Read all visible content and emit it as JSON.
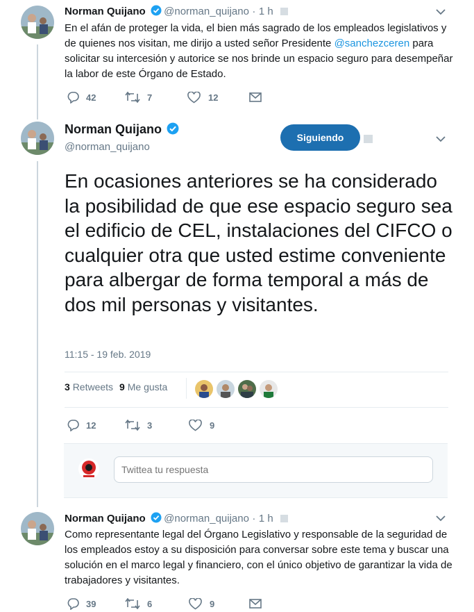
{
  "tweets": [
    {
      "name": "Norman Quijano",
      "handle": "@norman_quijano",
      "time": "1 h",
      "dot": "·",
      "text": "En el afán de proteger la vida, el bien más sagrado de los empleados legislativos y de quienes nos visitan, me dirijo a usted señor Presidente ",
      "mention": "@sanchezceren",
      "text_after": " para solicitar su intercesión y autorice se nos brinde un espacio seguro para desempeñar la labor de este Órgano de Estado.",
      "replies": "42",
      "retweets": "7",
      "likes": "12"
    },
    {
      "name": "Norman Quijano",
      "handle": "@norman_quijano",
      "follow_label": "Siguiendo",
      "text": "En ocasiones anteriores se ha considerado la posibilidad de que ese espacio seguro sea el edificio de CEL, instalaciones del CIFCO o cualquier otra que usted estime conveniente para albergar de forma temporal a más de dos mil personas y visitantes.",
      "timestamp": "11:15 - 19 feb. 2019",
      "retweets_count": "3",
      "retweets_label": "Retweets",
      "likes_count": "9",
      "likes_label": "Me gusta",
      "replies": "12",
      "retweets": "3",
      "likes": "9"
    },
    {
      "name": "Norman Quijano",
      "handle": "@norman_quijano",
      "time": "1 h",
      "dot": "·",
      "text": "Como representante legal del Órgano Legislativo y responsable de la seguridad de los empleados estoy a su disposición para conversar sobre este tema y buscar una solución en el marco legal y financiero, con el único objetivo de garantizar la vida de trabajadores y visitantes.",
      "replies": "39",
      "retweets": "6",
      "likes": "9"
    }
  ],
  "reply": {
    "placeholder": "Twittea tu respuesta"
  },
  "colors": {
    "verified": "#1da1f2",
    "follow_button": "#1d6fb0",
    "mention": "#1b95e0",
    "muted": "#657786"
  },
  "icons": [
    "reply-icon",
    "retweet-icon",
    "like-icon",
    "message-icon",
    "verified-icon",
    "chevron-down-icon"
  ]
}
